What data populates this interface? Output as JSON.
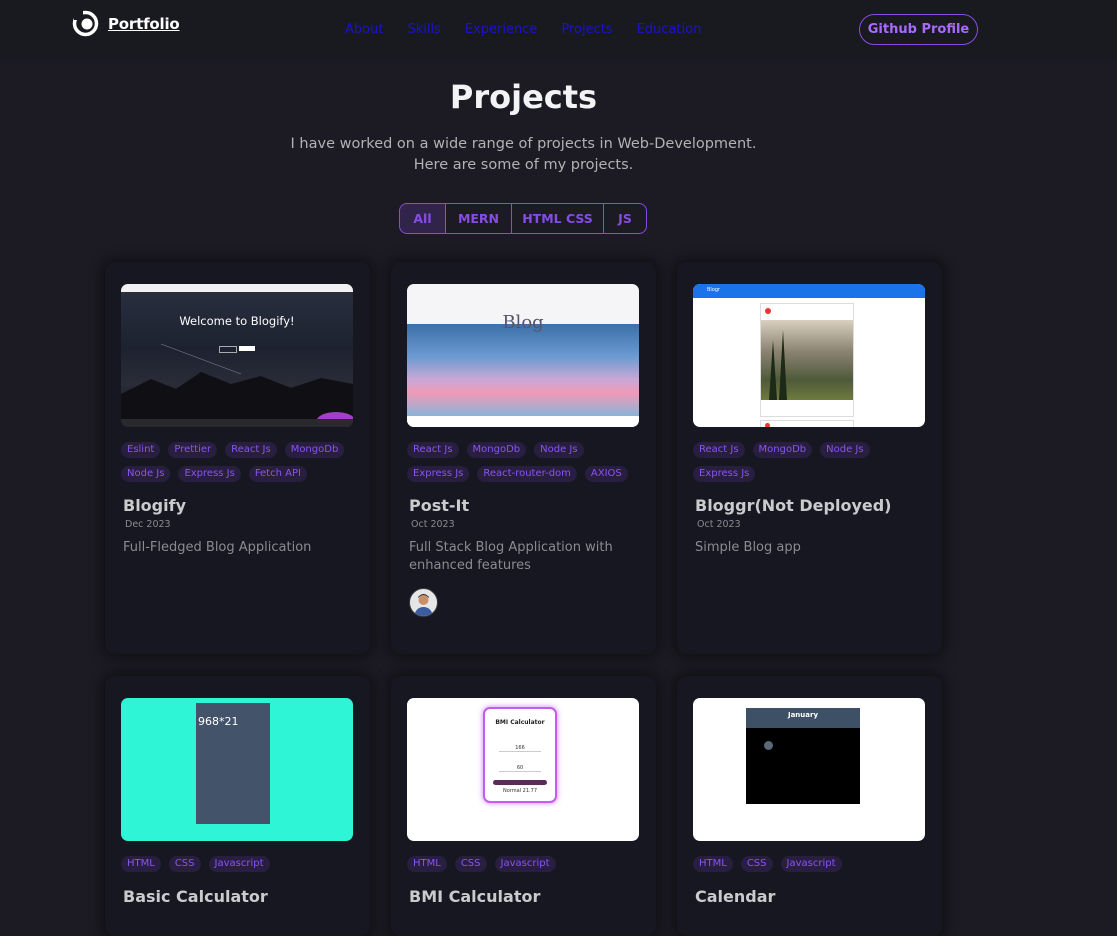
{
  "nav": {
    "logo_text": "Portfolio",
    "links": [
      "About",
      "Skills",
      "Experience",
      "Projects",
      "Education"
    ],
    "github_button": "Github Profile"
  },
  "header": {
    "title": "Projects",
    "subtitle_line1": "I have worked on a wide range of projects in Web-Development.",
    "subtitle_line2": "Here are some of my projects."
  },
  "filters": [
    "All",
    "MERN",
    "HTML CSS",
    "JS"
  ],
  "active_filter": "All",
  "projects": [
    {
      "title": "Blogify",
      "date": "Dec 2023",
      "description": "Full-Fledged Blog Application",
      "tags": [
        "Eslint",
        "Prettier",
        "React Js",
        "MongoDb",
        "Node Js",
        "Express Js",
        "Fetch API"
      ],
      "thumb_heading": "Welcome to Blogify!"
    },
    {
      "title": "Post-It",
      "date": "Oct 2023",
      "description": "Full Stack Blog Application with enhanced features",
      "tags": [
        "React Js",
        "MongoDb",
        "Node Js",
        "Express Js",
        "React-router-dom",
        "AXIOS"
      ],
      "thumb_heading": "Blog"
    },
    {
      "title": "Bloggr(Not Deployed)",
      "date": "Oct 2023",
      "description": "Simple Blog app",
      "tags": [
        "React Js",
        "MongoDb",
        "Node Js",
        "Express Js"
      ],
      "thumb_heading": "Blogr"
    },
    {
      "title": "Basic Calculator",
      "tags": [
        "HTML",
        "CSS",
        "Javascript"
      ],
      "thumb_heading": "968*21"
    },
    {
      "title": "BMI Calculator",
      "tags": [
        "HTML",
        "CSS",
        "Javascript"
      ],
      "thumb_heading": "BMI Calculator",
      "thumb_input1": "166",
      "thumb_input2": "60",
      "thumb_result": "Normal 21.77"
    },
    {
      "title": "Calendar",
      "tags": [
        "HTML",
        "CSS",
        "Javascript"
      ],
      "thumb_heading": "January"
    }
  ],
  "colors": {
    "background": "#1c1b23",
    "card": "#171721",
    "accent": "#854ce6",
    "nav_link": "#1a14c9"
  }
}
